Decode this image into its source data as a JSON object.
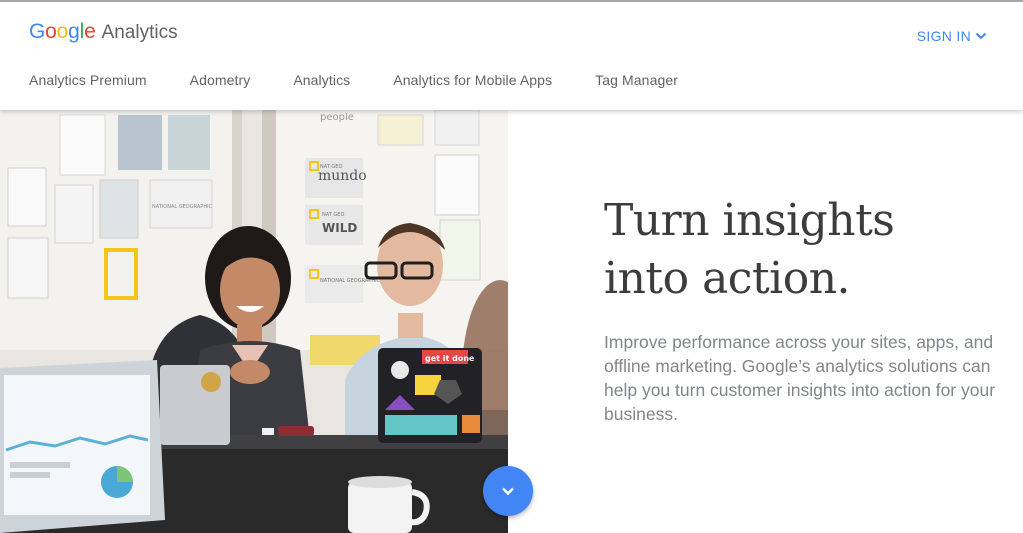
{
  "header": {
    "logo_brand": [
      "G",
      "o",
      "o",
      "g",
      "l",
      "e"
    ],
    "logo_brand_colors": [
      "#4285f4",
      "#ea4335",
      "#fbbc05",
      "#4285f4",
      "#34a853",
      "#ea4335"
    ],
    "logo_product": "Analytics",
    "sign_in_label": "SIGN IN",
    "sign_in_icon": "chevron-down-icon"
  },
  "nav": {
    "items": [
      {
        "label": "Analytics Premium"
      },
      {
        "label": "Adometry"
      },
      {
        "label": "Analytics"
      },
      {
        "label": "Analytics for Mobile Apps"
      },
      {
        "label": "Tag Manager"
      }
    ]
  },
  "hero": {
    "headline_line1": "Turn insights",
    "headline_line2": "into action.",
    "description": "Improve performance across your sites, apps, and offline marketing. Google’s analytics solutions can help you turn customer insights into action for your business.",
    "scroll_icon": "chevron-down-icon",
    "photo": {
      "wall_labels": [
        "people",
        "NAT GEO",
        "mundo",
        "NAT GEO",
        "WILD",
        "NATIONAL GEOGRAPHIC",
        "NATIONAL GEOGRAPHIC CHANNEL"
      ],
      "laptop_sticker": "get it done"
    }
  },
  "colors": {
    "accent": "#4285f4",
    "headline": "#3c3c3c",
    "body_text": "#80868b",
    "nav_text": "#5f6368"
  }
}
